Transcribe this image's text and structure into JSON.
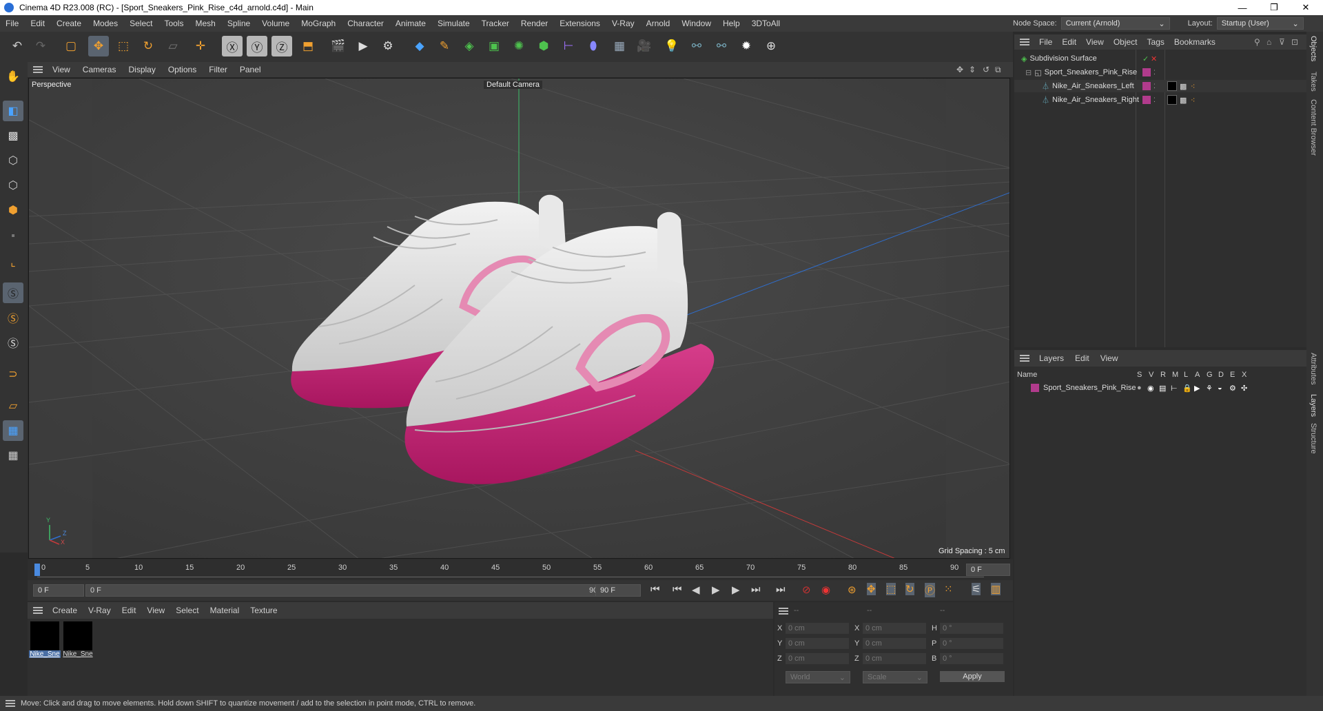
{
  "window": {
    "title": "Cinema 4D R23.008 (RC) - [Sport_Sneakers_Pink_Rise_c4d_arnold.c4d] - Main",
    "controls": [
      "—",
      "❐",
      "✕"
    ]
  },
  "menubar": {
    "items": [
      "File",
      "Edit",
      "Create",
      "Modes",
      "Select",
      "Tools",
      "Mesh",
      "Spline",
      "Volume",
      "MoGraph",
      "Character",
      "Animate",
      "Simulate",
      "Tracker",
      "Render",
      "Extensions",
      "V-Ray",
      "Arnold",
      "Window",
      "Help",
      "3DToAll"
    ]
  },
  "header_right": {
    "node_space_label": "Node Space:",
    "node_space_value": "Current (Arnold)",
    "layout_label": "Layout:",
    "layout_value": "Startup (User)"
  },
  "viewport": {
    "menu": [
      "View",
      "Cameras",
      "Display",
      "Options",
      "Filter",
      "Panel"
    ],
    "view_name": "Perspective",
    "camera": "Default Camera",
    "grid_spacing": "Grid Spacing : 5 cm",
    "axis_y": "Y",
    "axis_z": "Z",
    "axis_x": "X"
  },
  "timeline": {
    "ticks": [
      "0",
      "5",
      "10",
      "15",
      "20",
      "25",
      "30",
      "35",
      "40",
      "45",
      "50",
      "55",
      "60",
      "65",
      "70",
      "75",
      "80",
      "85",
      "90"
    ],
    "current_frame": "0 F"
  },
  "transport": {
    "start_field": "0 F",
    "range_start": "0 F",
    "range_end": "90 F",
    "end_field": "90 F"
  },
  "materials": {
    "menu": [
      "Create",
      "V-Ray",
      "Edit",
      "View",
      "Select",
      "Material",
      "Texture"
    ],
    "items": [
      {
        "label": "Nike_Sne"
      },
      {
        "label": "Nike_Sne"
      }
    ]
  },
  "coordinates": {
    "headers": [
      "--",
      "--",
      "--"
    ],
    "rows": [
      {
        "a": "X",
        "av": "0 cm",
        "b": "X",
        "bv": "0 cm",
        "c": "H",
        "cv": "0 °"
      },
      {
        "a": "Y",
        "av": "0 cm",
        "b": "Y",
        "bv": "0 cm",
        "c": "P",
        "cv": "0 °"
      },
      {
        "a": "Z",
        "av": "0 cm",
        "b": "Z",
        "bv": "0 cm",
        "c": "B",
        "cv": "0 °"
      }
    ],
    "space": "World",
    "mode": "Scale",
    "apply": "Apply"
  },
  "objects": {
    "menu": [
      "File",
      "Edit",
      "View",
      "Object",
      "Tags",
      "Bookmarks"
    ],
    "tree": [
      {
        "name": "Subdivision Surface"
      },
      {
        "name": "Sport_Sneakers_Pink_Rise"
      },
      {
        "name": "Nike_Air_Sneakers_Left"
      },
      {
        "name": "Nike_Air_Sneakers_Right"
      }
    ]
  },
  "layers": {
    "menu": [
      "Layers",
      "Edit",
      "View"
    ],
    "name_header": "Name",
    "flag_headers": [
      "S",
      "V",
      "R",
      "M",
      "L",
      "A",
      "G",
      "D",
      "E",
      "X"
    ],
    "rows": [
      {
        "name": "Sport_Sneakers_Pink_Rise"
      }
    ]
  },
  "side_tabs": [
    "Objects",
    "Takes",
    "Content Browser",
    "Attributes",
    "Layers",
    "Structure"
  ],
  "status": {
    "text": "Move: Click and drag to move elements. Hold down SHIFT to quantize movement / add to the selection in point mode, CTRL to remove."
  },
  "colors": {
    "accent": "#c0306f",
    "layer_color": "#b13b8c",
    "selection": "#5a6470"
  }
}
